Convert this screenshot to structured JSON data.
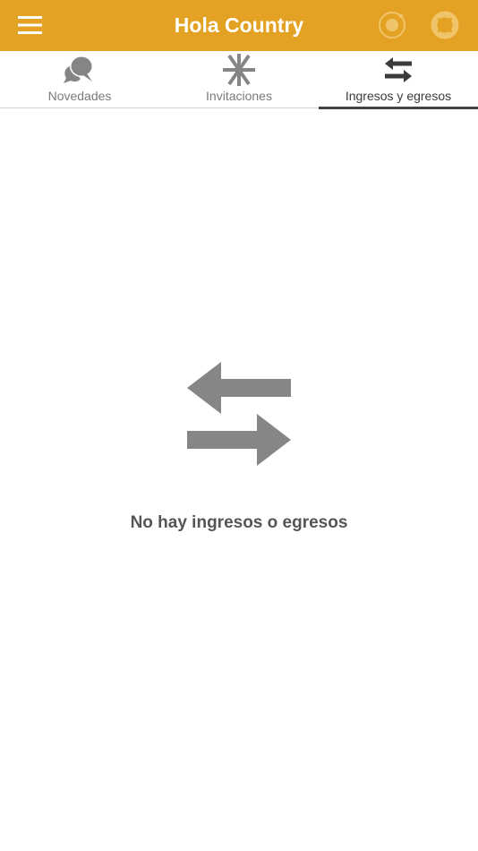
{
  "app_bar": {
    "title": "Hola Country",
    "background_color": "#e3a223",
    "menu_icon": "hamburger-menu-icon",
    "actions": [
      {
        "icon": "record-icon"
      },
      {
        "icon": "lifebuoy-icon"
      }
    ]
  },
  "tabs": [
    {
      "label": "Novedades",
      "icon": "chat-bubbles-icon",
      "active": false
    },
    {
      "label": "Invitaciones",
      "icon": "asterisk-icon",
      "active": false
    },
    {
      "label": "Ingresos y egresos",
      "icon": "swap-arrows-icon",
      "active": true
    }
  ],
  "empty_state": {
    "icon": "swap-arrows-icon",
    "message": "No hay ingresos o egresos"
  },
  "colors": {
    "accent": "#e3a223",
    "icon_gray": "#858585",
    "active_tab": "#444444"
  }
}
